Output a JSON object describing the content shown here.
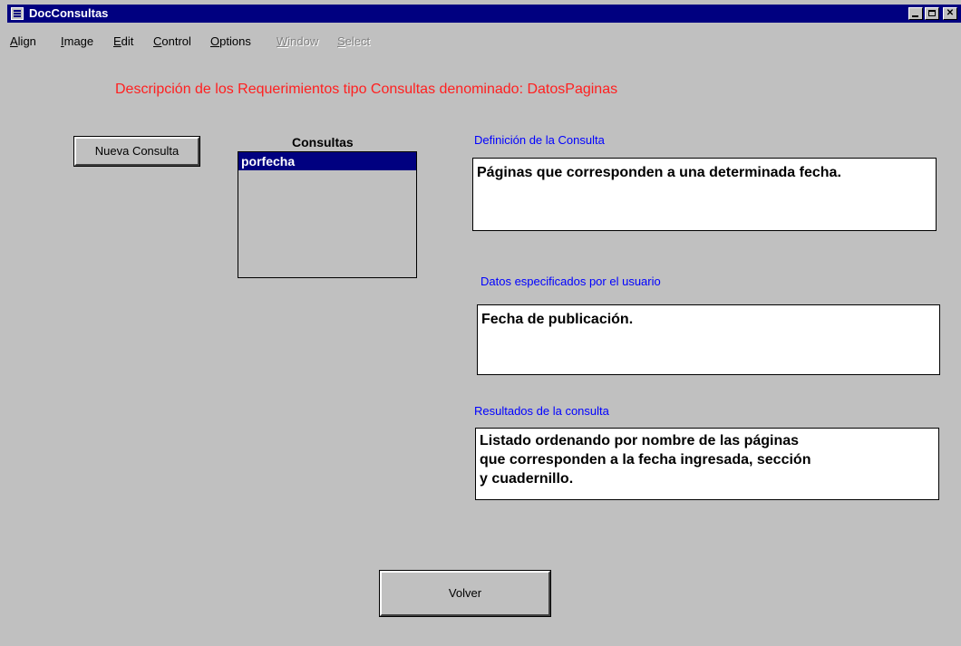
{
  "window": {
    "title": "DocConsultas",
    "controls": {
      "minimize": "",
      "maximize": "",
      "close": ""
    }
  },
  "menu": [
    {
      "accel": "A",
      "rest": "lign",
      "enabled": true
    },
    {
      "accel": "I",
      "rest": "mage",
      "enabled": true
    },
    {
      "accel": "E",
      "rest": "dit",
      "enabled": true
    },
    {
      "accel": "C",
      "rest": "ontrol",
      "enabled": true
    },
    {
      "accel": "O",
      "rest": "ptions",
      "enabled": true
    },
    {
      "accel": "W",
      "rest": "indow",
      "enabled": false
    },
    {
      "accel": "S",
      "rest": "elect",
      "enabled": false
    }
  ],
  "heading": "Descripción de los Requerimientos tipo Consultas denominado: DatosPaginas",
  "buttons": {
    "new_query": "Nueva Consulta",
    "back": "Volver"
  },
  "queries": {
    "label": "Consultas",
    "items": [
      "porfecha"
    ],
    "selected": "porfecha"
  },
  "definition": {
    "label": "Definición de la Consulta",
    "text": "Páginas que corresponden a una determinada fecha."
  },
  "user_data": {
    "label": "Datos especificados por el usuario",
    "text": "Fecha de publicación."
  },
  "results": {
    "label": "Resultados de la consulta",
    "text": "Listado ordenando por nombre de las páginas\nque corresponden a la fecha ingresada, sección\ny cuadernillo."
  },
  "colors": {
    "title_bar": "#000080",
    "heading": "#ff2020",
    "field_label": "#0000ff",
    "selection": "#000080",
    "window_bg": "#c0c0c0"
  }
}
